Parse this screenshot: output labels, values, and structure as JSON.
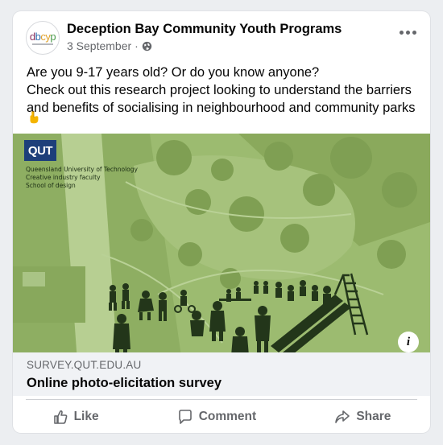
{
  "post": {
    "page_name": "Deception Bay Community Youth Programs",
    "date": "3 September",
    "separator": "·",
    "privacy_icon": "globe-icon",
    "avatar_logo": "dbcyp",
    "text_lines": [
      "Are you 9-17 years old? Or do you know anyone?",
      "Check out this research project looking to understand the barriers",
      "and benefits of socialising in neighbourhood and community parks"
    ],
    "emoji": "backhand-index-pointing-down-icon"
  },
  "media": {
    "logo_text": "QUT",
    "caption_lines": [
      "Queensland University of Technology",
      "Creative industry faculty",
      "School of design"
    ],
    "info_label": "i",
    "tint_color": "#98b86a"
  },
  "link": {
    "domain": "SURVEY.QUT.EDU.AU",
    "title": "Online photo-elicitation survey"
  },
  "actions": {
    "like": "Like",
    "comment": "Comment",
    "share": "Share"
  }
}
